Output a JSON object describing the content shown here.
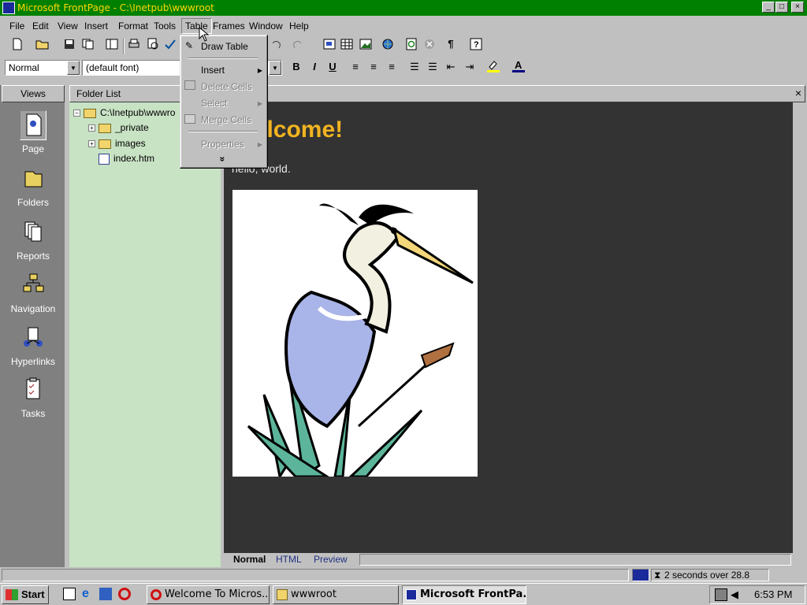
{
  "window": {
    "title": "Microsoft FrontPage - C:\\Inetpub\\wwwroot",
    "min": "_",
    "max": "□",
    "close": "×"
  },
  "menubar": [
    "File",
    "Edit",
    "View",
    "Insert",
    "Format",
    "Tools",
    "Table",
    "Frames",
    "Window",
    "Help"
  ],
  "formatting": {
    "style_value": "Normal",
    "font_value": "(default font)"
  },
  "table_menu": {
    "items": [
      {
        "label": "Draw Table",
        "enabled": true
      },
      {
        "label": "Insert",
        "enabled": true,
        "submenu": true
      },
      {
        "label": "Delete Cells",
        "enabled": false
      },
      {
        "label": "Select",
        "enabled": false,
        "submenu": true
      },
      {
        "label": "Merge Cells",
        "enabled": false
      },
      {
        "label": "Properties",
        "enabled": false,
        "submenu": true
      }
    ],
    "more": "»"
  },
  "views": {
    "header": "Views",
    "items": [
      {
        "label": "Page",
        "icon": "page-icon"
      },
      {
        "label": "Folders",
        "icon": "folders-icon"
      },
      {
        "label": "Reports",
        "icon": "reports-icon"
      },
      {
        "label": "Navigation",
        "icon": "navigation-icon"
      },
      {
        "label": "Hyperlinks",
        "icon": "hyperlinks-icon"
      },
      {
        "label": "Tasks",
        "icon": "tasks-icon"
      }
    ]
  },
  "folder_list": {
    "header": "Folder List",
    "root": "C:\\Inetpub\\wwwro",
    "items": [
      "_private",
      "images",
      "index.htm"
    ]
  },
  "editor": {
    "heading": "Welcome!",
    "body": "hello, world.",
    "close": "×"
  },
  "tabs": [
    "Normal",
    "HTML",
    "Preview"
  ],
  "status": {
    "download_time": "2 seconds over 28.8"
  },
  "taskbar": {
    "start": "Start",
    "tasks": [
      "Welcome To Micros...",
      "wwwroot",
      "Microsoft FrontPa..."
    ],
    "clock": "6:53 PM"
  },
  "colors": {
    "titlebar": "#008000",
    "title_text": "#ffd700",
    "heading": "#f0b321",
    "folder_panel": "#c8e2c4",
    "editor_bg": "#333333"
  }
}
